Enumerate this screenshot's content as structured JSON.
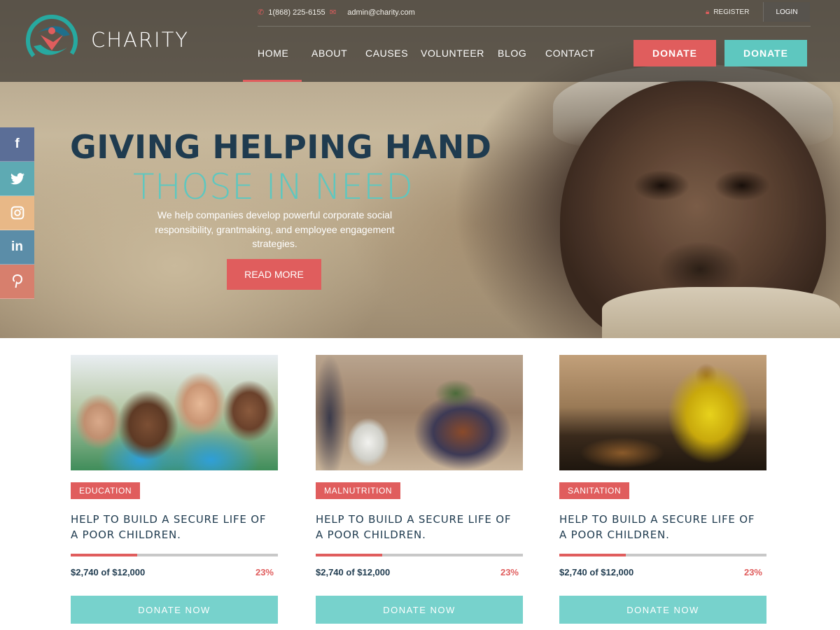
{
  "brand": {
    "name": "CHARITY"
  },
  "topbar": {
    "phone": "1(868) 225-6155",
    "email": "admin@charity.com",
    "register_label": "REGISTER",
    "login_label": "LOGIN"
  },
  "nav": {
    "items": [
      {
        "label": "HOME",
        "active": true
      },
      {
        "label": "ABOUT"
      },
      {
        "label": "CAUSES"
      },
      {
        "label": "VOLUNTEER"
      },
      {
        "label": "BLOG"
      },
      {
        "label": "CONTACT"
      }
    ],
    "donate_primary": "DONATE",
    "donate_secondary": "DONATE"
  },
  "social": [
    {
      "icon": "facebook-icon",
      "glyph": "f",
      "color": "#5b6e97"
    },
    {
      "icon": "twitter-icon",
      "glyph": "🐦",
      "color": "#5eaab3"
    },
    {
      "icon": "instagram-icon",
      "glyph": "◎",
      "color": "#e8b887"
    },
    {
      "icon": "linkedin-icon",
      "glyph": "in",
      "color": "#5b8da8"
    },
    {
      "icon": "pinterest-icon",
      "glyph": "P",
      "color": "#d77f6d"
    }
  ],
  "hero": {
    "title": "GIVING HELPING HAND",
    "subtitle": "THOSE IN NEED",
    "description": "We help companies develop powerful corporate social responsibility, grantmaking, and employee engagement strategies.",
    "cta_label": "READ MORE"
  },
  "causes": [
    {
      "tag": "EDUCATION",
      "title": "HELP TO BUILD A SECURE LIFE OF A POOR CHILDREN.",
      "raised": "$2,740 of $12,000",
      "percent_label": "23%",
      "progress": 0.32,
      "button": "DONATE NOW"
    },
    {
      "tag": "MALNUTRITION",
      "title": "HELP TO BUILD A SECURE LIFE OF A POOR CHILDREN.",
      "raised": "$2,740 of $12,000",
      "percent_label": "23%",
      "progress": 0.32,
      "button": "DONATE NOW"
    },
    {
      "tag": "SANITATION",
      "title": "HELP TO BUILD A SECURE LIFE OF A POOR CHILDREN.",
      "raised": "$2,740 of $12,000",
      "percent_label": "23%",
      "progress": 0.32,
      "button": "DONATE NOW"
    }
  ],
  "colors": {
    "accent_red": "#e05d5d",
    "accent_teal": "#5ec7bf",
    "navy": "#1f3b4f"
  }
}
